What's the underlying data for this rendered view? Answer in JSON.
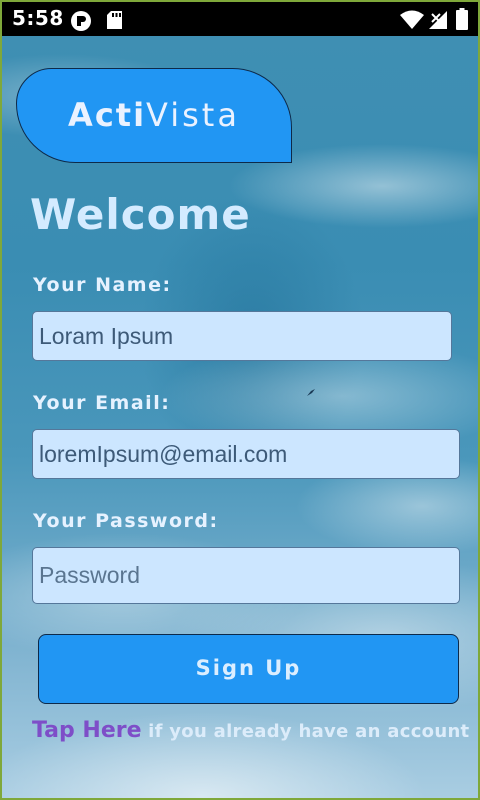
{
  "status_bar": {
    "time": "5:58",
    "left_icons": [
      "app-notification-icon",
      "sd-card-icon"
    ],
    "right_icons": [
      "wifi-icon",
      "cell-signal-icon",
      "battery-icon"
    ]
  },
  "logo": {
    "part_bold": "Acti",
    "part_light": "Vista"
  },
  "welcome_title": "Welcome",
  "form": {
    "name_label": "Your Name:",
    "name_value": "Loram Ipsum",
    "email_label": "Your Email:",
    "email_value": "loremIpsum@email.com",
    "password_label": "Your Password:",
    "password_placeholder": "Password"
  },
  "signup_button_label": "Sign Up",
  "footer": {
    "link_text": "Tap Here",
    "rest_text": " if you already have an account"
  },
  "colors": {
    "accent": "#2196f3",
    "input_bg": "#cce6ff",
    "link": "#7e4ec8",
    "status_bar_bg": "#000000"
  }
}
